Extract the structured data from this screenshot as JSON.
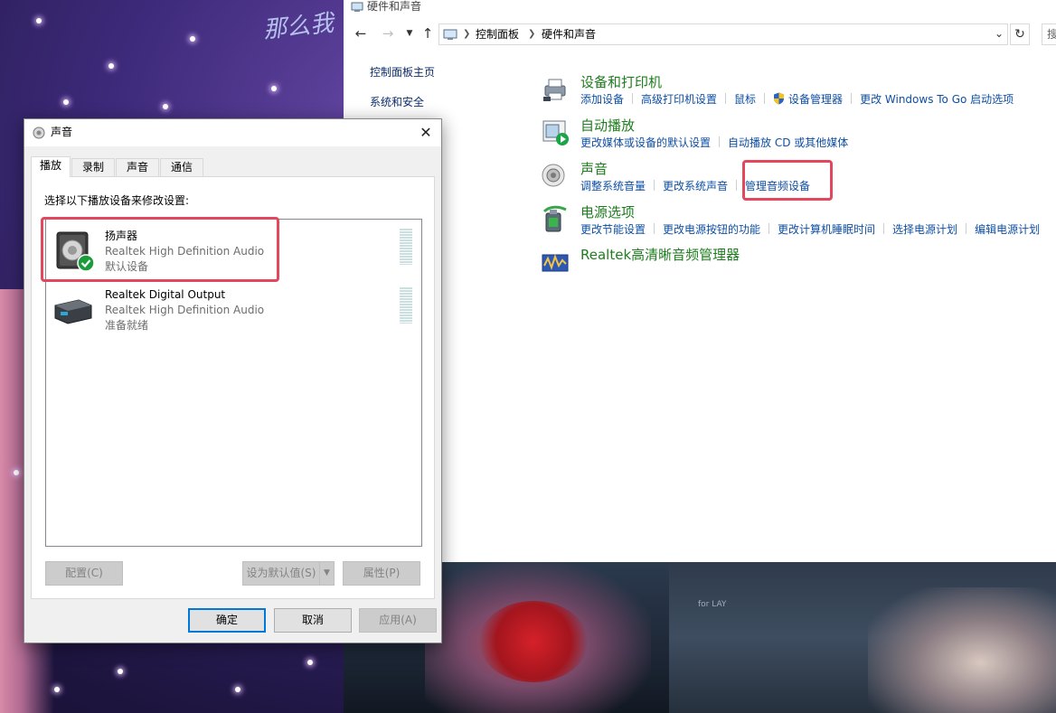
{
  "wallpaper": {
    "overlay_text": "那么我",
    "piano_text": "for LAY"
  },
  "control_panel": {
    "title": "硬件和声音",
    "breadcrumbs": [
      "控制面板",
      "硬件和声音"
    ],
    "search_placeholder": "搜",
    "sidebar": {
      "items": [
        "控制面板主页",
        "系统和安全"
      ]
    },
    "categories": [
      {
        "title": "设备和打印机",
        "icon": "printer-icon",
        "links": [
          "添加设备",
          "高级打印机设置",
          "鼠标",
          "设备管理器",
          "更改 Windows To Go 启动选项"
        ]
      },
      {
        "title": "自动播放",
        "icon": "autoplay-icon",
        "links": [
          "更改媒体或设备的默认设置",
          "自动播放 CD 或其他媒体"
        ]
      },
      {
        "title": "声音",
        "icon": "speaker-icon",
        "links": [
          "调整系统音量",
          "更改系统声音",
          "管理音频设备"
        ]
      },
      {
        "title": "电源选项",
        "icon": "power-options-icon",
        "links": [
          "更改节能设置",
          "更改电源按钮的功能",
          "更改计算机睡眠时间",
          "选择电源计划",
          "编辑电源计划"
        ]
      },
      {
        "title": "Realtek高清晰音频管理器",
        "icon": "realtek-audio-icon",
        "links": []
      }
    ],
    "highlight_color": "#e2475e"
  },
  "sound_dialog": {
    "title": "声音",
    "close_label": "✕",
    "tabs": [
      "播放",
      "录制",
      "声音",
      "通信"
    ],
    "active_tab": "播放",
    "instruction": "选择以下播放设备来修改设置:",
    "devices": [
      {
        "name": "扬声器",
        "driver": "Realtek High Definition Audio",
        "status": "默认设备",
        "icon": "speaker-device-icon",
        "default": true
      },
      {
        "name": "Realtek Digital Output",
        "driver": "Realtek High Definition Audio",
        "status": "准备就绪",
        "icon": "digital-output-icon",
        "default": false
      }
    ],
    "buttons": {
      "configure": "配置(C)",
      "set_default": "设为默认值(S)",
      "properties": "属性(P)",
      "ok": "确定",
      "cancel": "取消",
      "apply": "应用(A)"
    },
    "accent_color": "#0078d7",
    "default_check_color": "#1a9c3a"
  }
}
